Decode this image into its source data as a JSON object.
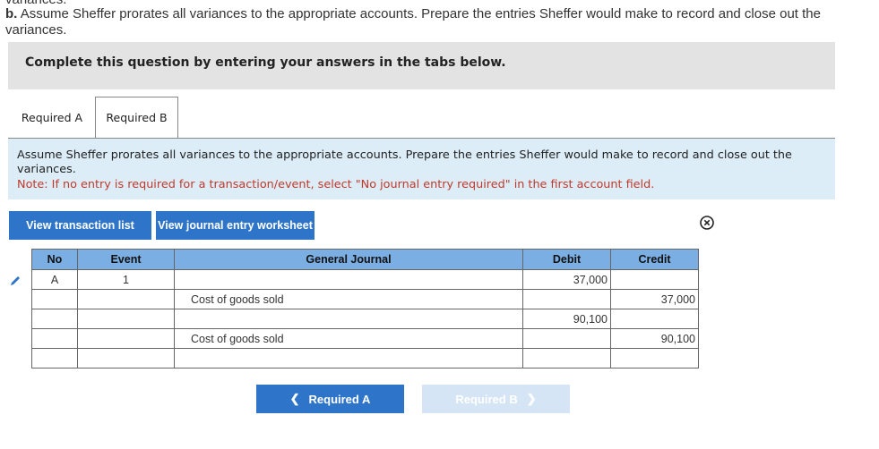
{
  "question": {
    "cut_top": "variances.",
    "part_label": "b.",
    "text": "Assume Sheffer prorates all variances to the appropriate accounts. Prepare the entries Sheffer would make to record and close out the variances."
  },
  "banner": {
    "text": "Complete this question by entering your answers in the tabs below."
  },
  "tabs": [
    {
      "label": "Required A"
    },
    {
      "label": "Required B"
    }
  ],
  "instructions": {
    "text": "Assume Sheffer prorates all variances to the appropriate accounts. Prepare the entries Sheffer would make to record and close out the variances.",
    "note": "Note: If no entry is required for a transaction/event, select \"No journal entry required\" in the first account field."
  },
  "buttons": {
    "view_transactions": "View transaction list",
    "view_worksheet": "View journal entry worksheet"
  },
  "journal": {
    "headers": {
      "no": "No",
      "event": "Event",
      "general_journal": "General Journal",
      "debit": "Debit",
      "credit": "Credit"
    },
    "rows": [
      {
        "no": "A",
        "event": "1",
        "account": "",
        "debit": "37,000",
        "credit": ""
      },
      {
        "no": "",
        "event": "",
        "account": "Cost of goods sold",
        "debit": "",
        "credit": "37,000"
      },
      {
        "no": "",
        "event": "",
        "account": "",
        "debit": "90,100",
        "credit": ""
      },
      {
        "no": "",
        "event": "",
        "account": "Cost of goods sold",
        "debit": "",
        "credit": "90,100"
      },
      {
        "no": "",
        "event": "",
        "account": "",
        "debit": "",
        "credit": ""
      }
    ]
  },
  "nav": {
    "prev_label": "Required A",
    "next_label": "Required B"
  },
  "colors": {
    "accent": "#2e75c9",
    "header": "#7baee2",
    "info_bg": "#dcedf8",
    "note": "#c0392b"
  },
  "icons": {
    "close": "close-circle-icon",
    "edit": "pencil-icon"
  }
}
